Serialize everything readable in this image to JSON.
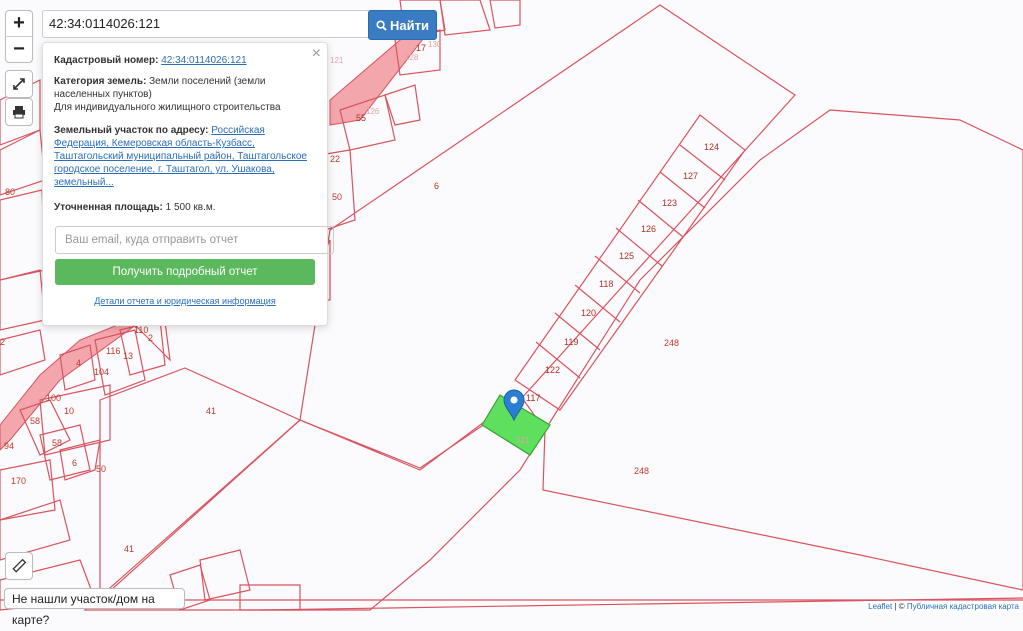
{
  "search": {
    "query": "42:34:0114026:121",
    "button_label": "Найти"
  },
  "zoom": {
    "in_label": "+",
    "out_label": "−"
  },
  "popup": {
    "close_label": "×",
    "cadastral_label": "Кадастровый номер:",
    "cadastral_value": "42:34:0114026:121",
    "category_label": "Категория земель:",
    "category_line1": "Земли поселений (земли",
    "category_line2": "населенных пунктов)",
    "category_line3": "Для индивидуального жилищного строительства",
    "address_label": "Земельный участок по адресу:",
    "address_line1": "Российская",
    "address_line2": "Федерация, Кемеровская область-Кузбасс,",
    "address_line3": "Таштагольский муниципальный район, Таштагольское",
    "address_line4": "городское поселение, г. Таштагол, ул. Ушакова,",
    "address_line5": "земельный...",
    "area_label": "Уточненная площадь:",
    "area_value": "1 500 кв.м.",
    "email_placeholder": "Ваш email, куда отправить отчет",
    "report_button": "Получить подробный отчет",
    "details_link": "Детали отчета и юридическая информация"
  },
  "bottom_card": {
    "label": "Не нашли участок/дом на карте?"
  },
  "attribution": {
    "leaflet": "Leaflet",
    "separator": " | © ",
    "source": "Публичная кадастровая карта"
  },
  "parcel_labels": [
    "124",
    "127",
    "123",
    "126",
    "125",
    "118",
    "120",
    "119",
    "122",
    "117",
    "121",
    "248",
    "248",
    "6",
    "41",
    "41",
    "50",
    "50",
    "22",
    "55",
    "126",
    "17",
    "128",
    "130",
    "121",
    "104",
    "110",
    "2",
    "13",
    "116",
    "4",
    "100",
    "10",
    "58",
    "58",
    "6",
    "94",
    "170",
    "80",
    "2"
  ],
  "colors": {
    "parcel_stroke": "#d9545f",
    "selected_fill": "#5ee05e",
    "marker": "#2a7fd4",
    "search_button": "#3a7cc3",
    "report_button": "#5cb85c"
  },
  "icons": [
    "search-icon",
    "fullscreen-icon",
    "print-icon",
    "ruler-icon",
    "map-marker-icon",
    "close-icon"
  ]
}
